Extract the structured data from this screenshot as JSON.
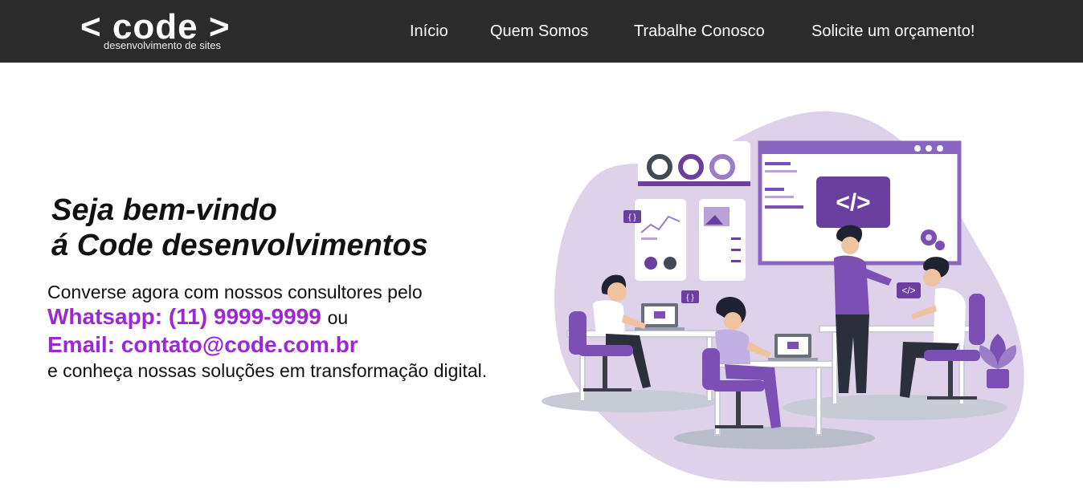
{
  "header": {
    "logo": {
      "main": "< code >",
      "sub": "desenvolvimento de sites"
    },
    "nav": [
      {
        "label": "Início"
      },
      {
        "label": "Quem Somos"
      },
      {
        "label": "Trabalhe Conosco"
      },
      {
        "label": "Solicite um orçamento!"
      }
    ]
  },
  "hero": {
    "title_line1": "Seja bem-vindo",
    "title_line2": "á Code desenvolvimentos",
    "intro": "Converse agora com nossos consultores pelo",
    "whatsapp": "Whatsapp: (11) 9999-9999",
    "or": "ou",
    "email": "Email: contato@code.com.br",
    "outro": "e conheça nossas soluções em transformação digital."
  },
  "illustration": {
    "code_tag": "</>",
    "braces": "{ }"
  },
  "colors": {
    "navbar_bg": "#2b2b2b",
    "accent": "#9b27d6",
    "illustration_purple": "#6b3fa0",
    "illustration_lavender": "#ddd2ea"
  }
}
